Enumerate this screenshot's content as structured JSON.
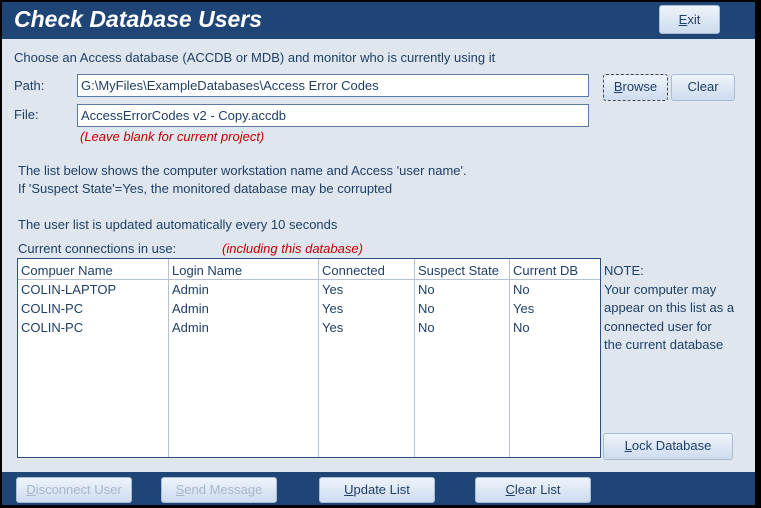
{
  "title": "Check Database Users",
  "exit_label": "Exit",
  "intro": "Choose an Access database (ACCDB or MDB) and monitor who is currently using it",
  "path_label": "Path:",
  "path_value": "G:\\MyFiles\\ExampleDatabases\\Access Error Codes",
  "file_label": "File:",
  "file_value": "AccessErrorCodes v2 - Copy.accdb",
  "file_hint": "(Leave blank for current project)",
  "browse_label": "Browse",
  "clear_label": "Clear",
  "info1": "The list below shows the computer workstation name and Access 'user name'.",
  "info2": "If 'Suspect State'=Yes, the monitored database may be corrupted",
  "info3": "The user list is updated automatically every 10 seconds",
  "connections_label": "Current connections in use:",
  "connections_hint": "(including this database)",
  "columns": [
    "Compuer Name",
    "Login Name",
    "Connected",
    "Suspect State",
    "Current DB"
  ],
  "rows": [
    [
      "COLIN-LAPTOP",
      "Admin",
      "Yes",
      "No",
      "No"
    ],
    [
      "COLIN-PC",
      "Admin",
      "Yes",
      "No",
      "Yes"
    ],
    [
      "COLIN-PC",
      "Admin",
      "Yes",
      "No",
      "No"
    ]
  ],
  "note_title": "NOTE:",
  "note_lines": [
    "Your computer may",
    "appear on this list as a",
    "connected user for",
    "the current database"
  ],
  "lock_label": "Lock Database",
  "footer": {
    "disconnect": "Disconnect User",
    "send": "Send Message",
    "update": "Update List",
    "clear_list": "Clear List"
  }
}
